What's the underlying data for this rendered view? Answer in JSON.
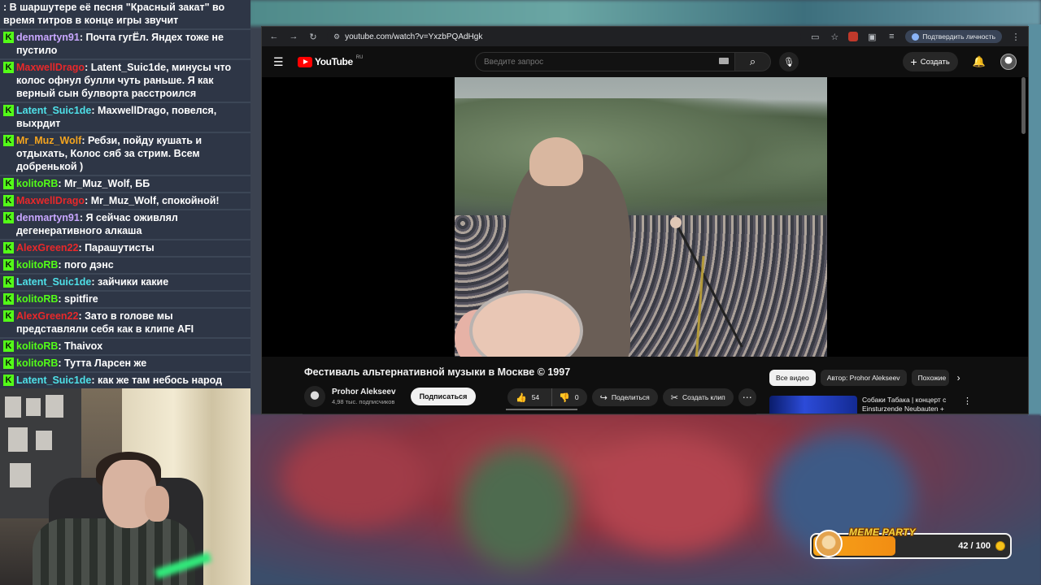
{
  "chat": {
    "messages": [
      {
        "user": "",
        "user_color": "#ffffff",
        "text": ": В шаршутере её песня \"Красный закат\" во время титров в конце игры звучит"
      },
      {
        "user": "denmartyn91",
        "user_color": "#c9a7ff",
        "text": ": Почта гугЁл. Яндех тоже не пустило"
      },
      {
        "user": "MaxwellDrago",
        "user_color": "#e8282a",
        "text": ": Latent_Suic1de, минусы что колос офнул булли чуть раньше. Я как верный сын булворта расстроился"
      },
      {
        "user": "Latent_Suic1de",
        "user_color": "#4fe0e8",
        "text": ": MaxwellDrago, повелся, выхрдит"
      },
      {
        "user": "Mr_Muz_Wolf",
        "user_color": "#f3a41f",
        "text": ": Ребзи, пойду кушать и отдыхать, Колос сяб за стрим. Всем добренькой )"
      },
      {
        "user": "kolitoRB",
        "user_color": "#53fc18",
        "text": ": Mr_Muz_Wolf, ББ"
      },
      {
        "user": "MaxwellDrago",
        "user_color": "#e8282a",
        "text": ": Mr_Muz_Wolf, спокойной!"
      },
      {
        "user": "denmartyn91",
        "user_color": "#c9a7ff",
        "text": ": Я сейчас оживлял дегенеративного алкаша"
      },
      {
        "user": "AlexGreen22",
        "user_color": "#e8282a",
        "text": ": Парашутисты"
      },
      {
        "user": "kolitoRB",
        "user_color": "#53fc18",
        "text": ": пого дэнс"
      },
      {
        "user": "Latent_Suic1de",
        "user_color": "#4fe0e8",
        "text": ": зайчики какие"
      },
      {
        "user": "kolitoRB",
        "user_color": "#53fc18",
        "text": ": spitfire"
      },
      {
        "user": "AlexGreen22",
        "user_color": "#e8282a",
        "text": ": Зато в голове мы представляли себя как в клипе AFI"
      },
      {
        "user": "kolitoRB",
        "user_color": "#53fc18",
        "text": ": Thaivox"
      },
      {
        "user": "kolitoRB",
        "user_color": "#53fc18",
        "text": ": Тутта Ларсен же"
      },
      {
        "user": "Latent_Suic1de",
        "user_color": "#4fe0e8",
        "text": ": как же там небось народ охуевает у лестницы"
      }
    ]
  },
  "browser": {
    "url": "youtube.com/watch?v=YxzbPQAdHgk",
    "verify_label": "Подтвердить личность"
  },
  "youtube": {
    "logo_text": "YouTube",
    "country": "RU",
    "search_placeholder": "Введите запрос",
    "create_label": "Создать",
    "video_title": "Фестиваль альтернативной музыки в Москве © 1997",
    "channel_name": "Prohor Alekseev",
    "subscribers": "4,98 тыс. подписчиков",
    "subscribe_label": "Подписаться",
    "likes": "54",
    "dislikes": "0",
    "share_label": "Поделиться",
    "clip_label": "Создать клип",
    "chips": [
      "Все видео",
      "Автор: Prohor Alekseev",
      "Похожие"
    ],
    "rec_title": "Собаки Табака | концерт с Einsturzende Neubauten +"
  },
  "meme_party": {
    "title": "MEME PARTY",
    "count": "42 / 100",
    "progress_fraction": 0.42
  }
}
